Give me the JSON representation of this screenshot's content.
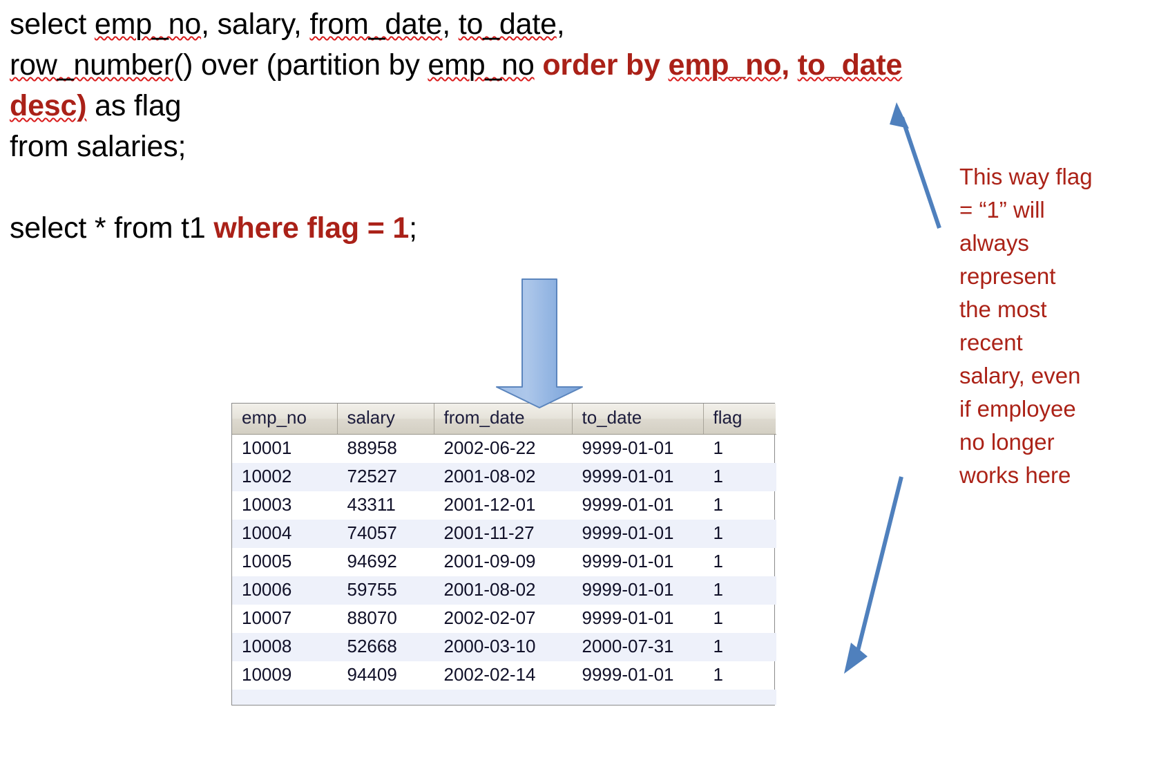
{
  "slide": {
    "background_color": "#ffffff",
    "accent_red": "#aa2118",
    "arrow_blue": "#5b8cc4",
    "spellcheck_underline_color": "#d91b1b"
  },
  "code": {
    "line1_a": "select ",
    "line1_b": "emp_no",
    "line1_c": ", salary, ",
    "line1_d": "from_date",
    "line1_e": ", ",
    "line1_f": "to_date",
    "line1_g": ",",
    "line2_a": "row_number",
    "line2_b": "() over (partition by ",
    "line2_c": "emp_no",
    "line2_d": " ",
    "line2_hl1": "order by ",
    "line2_hl2": "emp_no",
    "line2_hl3": ", ",
    "line2_hl4": "to_date",
    "line3_hl": "desc)",
    "line3_rest": " as flag",
    "line4": "from salaries;",
    "line5_a": "select * from t1 ",
    "line5_hl": "where flag = 1",
    "line5_b": ";"
  },
  "table": {
    "columns": [
      "emp_no",
      "salary",
      "from_date",
      "to_date",
      "flag"
    ],
    "rows": [
      [
        "10001",
        "88958",
        "2002-06-22",
        "9999-01-01",
        "1"
      ],
      [
        "10002",
        "72527",
        "2001-08-02",
        "9999-01-01",
        "1"
      ],
      [
        "10003",
        "43311",
        "2001-12-01",
        "9999-01-01",
        "1"
      ],
      [
        "10004",
        "74057",
        "2001-11-27",
        "9999-01-01",
        "1"
      ],
      [
        "10005",
        "94692",
        "2001-09-09",
        "9999-01-01",
        "1"
      ],
      [
        "10006",
        "59755",
        "2001-08-02",
        "9999-01-01",
        "1"
      ],
      [
        "10007",
        "88070",
        "2002-02-07",
        "9999-01-01",
        "1"
      ],
      [
        "10008",
        "52668",
        "2000-03-10",
        "2000-07-31",
        "1"
      ],
      [
        "10009",
        "94409",
        "2002-02-14",
        "9999-01-01",
        "1"
      ]
    ]
  },
  "annotation": {
    "lines": [
      "This way flag",
      "= “1” will",
      "always",
      "represent",
      "the most",
      "recent",
      "salary, even",
      "if employee",
      "no longer",
      "works here"
    ],
    "text": "This way flag = “1” will always represent the most recent salary, even if employee no longer works here"
  }
}
